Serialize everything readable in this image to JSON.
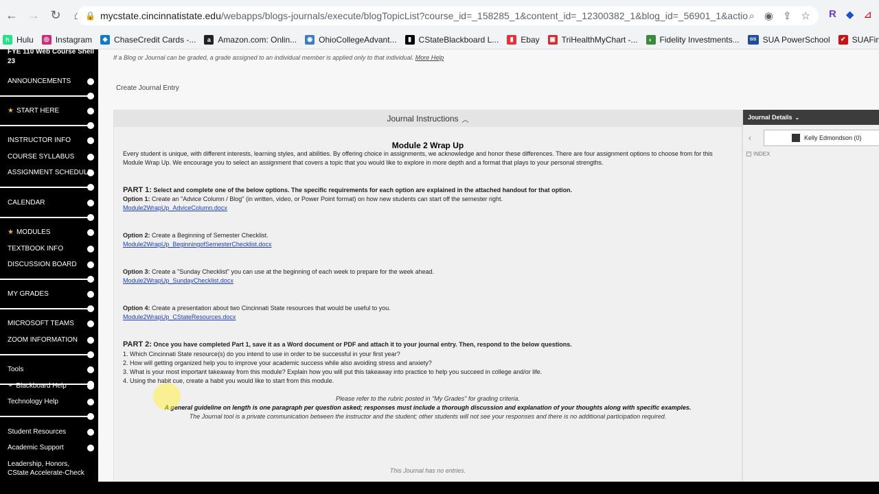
{
  "browser": {
    "url_host": "mycstate.cincinnatistate.edu",
    "url_path": "/webapps/blogs-journals/execute/blogTopicList?course_id=_158285_1&content_id=_12300382_1&blog_id=_56901_1&action=cont...",
    "bookmarks": [
      {
        "label": "Hulu",
        "color": "#1ce783",
        "glyph": "h"
      },
      {
        "label": "Instagram",
        "color": "#d62976",
        "glyph": "◎"
      },
      {
        "label": "ChaseCredit Cards -...",
        "color": "#117aca",
        "glyph": "◆"
      },
      {
        "label": "Amazon.com: Onlin...",
        "color": "#222222",
        "glyph": "a"
      },
      {
        "label": "OhioCollegeAdvant...",
        "color": "#3b7ec2",
        "glyph": "◉"
      },
      {
        "label": "CStateBlackboard L...",
        "color": "#000000",
        "glyph": "▮"
      },
      {
        "label": "Ebay",
        "color": "#e53238",
        "glyph": "▮"
      },
      {
        "label": "TriHealthMyChart -...",
        "color": "#d03030",
        "glyph": "▣"
      },
      {
        "label": "Fidelity Investments...",
        "color": "#3a8a3a",
        "glyph": "◐"
      },
      {
        "label": "SUA PowerSchool",
        "color": "#1f4e9e",
        "glyph": "SIS"
      },
      {
        "label": "SUAFinalForms: ke",
        "color": "#d01010",
        "glyph": "✔"
      }
    ]
  },
  "sidebar": {
    "course_title_line1": "FYE 110 Web Course Shell",
    "course_title_line2": "23",
    "items": [
      {
        "label": "ANNOUNCEMENTS"
      },
      {
        "label": "START HERE"
      },
      {
        "label": "INSTRUCTOR INFO"
      },
      {
        "label": "COURSE SYLLABUS"
      },
      {
        "label": "ASSIGNMENT SCHEDULE"
      },
      {
        "label": "CALENDAR"
      },
      {
        "label": "MODULES"
      },
      {
        "label": "TEXTBOOK INFO"
      },
      {
        "label": "DISCUSSION BOARD"
      },
      {
        "label": "MY GRADES"
      },
      {
        "label": "MICROSOFT TEAMS"
      },
      {
        "label": "ZOOM INFORMATION"
      },
      {
        "label": "Tools"
      },
      {
        "label": "Blackboard Help"
      },
      {
        "label": "Technology Help"
      },
      {
        "label": "Student Resources"
      },
      {
        "label": "Academic Support"
      },
      {
        "label": "Leadership, Honors,"
      },
      {
        "label": "CState Accelerate-Check"
      }
    ]
  },
  "page": {
    "grade_note": "If a Blog or Journal can be graded, a grade assigned to an individual member is applied only to that individual.",
    "more_help": "More Help",
    "create_entry": "Create Journal Entry",
    "panel_title": "Journal Instructions",
    "module_title": "Module 2 Wrap Up",
    "intro": "Every student is unique, with different interests, learning styles, and abilities. By offering choice in assignments, we acknowledge and honor these differences. There are four assignment options to choose from for this Module Wrap Up.  We encourage you to select an assignment that covers a topic that you would like to explore in more depth and a format that plays to your personal strengths.",
    "part1_label": "PART 1:",
    "part1_text": "Select and complete one of the below options.  The specific requirements for each option are explained in the attached handout for that option.",
    "options": [
      {
        "label": "Option 1:",
        "text": "Create an \"Advice Column / Blog\" (in written, video, or Power Point format) on how new students can start off the semester right.",
        "file": "Module2WrapUp_AdviceColumn.docx"
      },
      {
        "label": "Option 2:",
        "text": "Create a Beginning of Semester Checklist.",
        "file": "Module2WrapUp_BeginningofSemesterChecklist.docx"
      },
      {
        "label": "Option 3:",
        "text": "Create a \"Sunday Checklist\" you can use at the beginning of each week to prepare for the week ahead.",
        "file": "Module2WrapUp_SundayChecklist.docx"
      },
      {
        "label": "Option 4:",
        "text": "Create a presentation about two Cincinnati State resources that would be useful to you.",
        "file": "Module2WrapUp_CStateResources.docx"
      }
    ],
    "part2_label": "PART 2:",
    "part2_text": "Once you have completed Part 1, save it as a Word document or PDF and attach it to your journal entry.  Then, respond to the below questions.",
    "questions": [
      "1.  Which Cincinnati State resource(s) do you intend to use in order to be successful in your first year?",
      "2.  How will getting organized help you to improve your academic success while also avoiding stress and anxiety?",
      "3. What is your most important takeaway from this module? Explain how you will put this takeaway into practice to help you succeed in college and/or life.",
      "4. Using the habit cue, create a habit you would like to start from this module."
    ],
    "rubric_note": "Please refer to the rubric posted in \"My Grades\" for grading criteria.",
    "guideline_note": "A general guideline on length is one paragraph per question asked; responses must include a thorough discussion and explanation of your thoughts along with specific examples.",
    "privacy_note": "The Journal tool is a private communication between the instructor and the student; other students will not see your responses and there is no additional participation required.",
    "no_entries": "This Journal has no entries."
  },
  "details": {
    "header": "Journal Details",
    "user": "Kelly Edmondson (0)",
    "index": "INDEX"
  }
}
